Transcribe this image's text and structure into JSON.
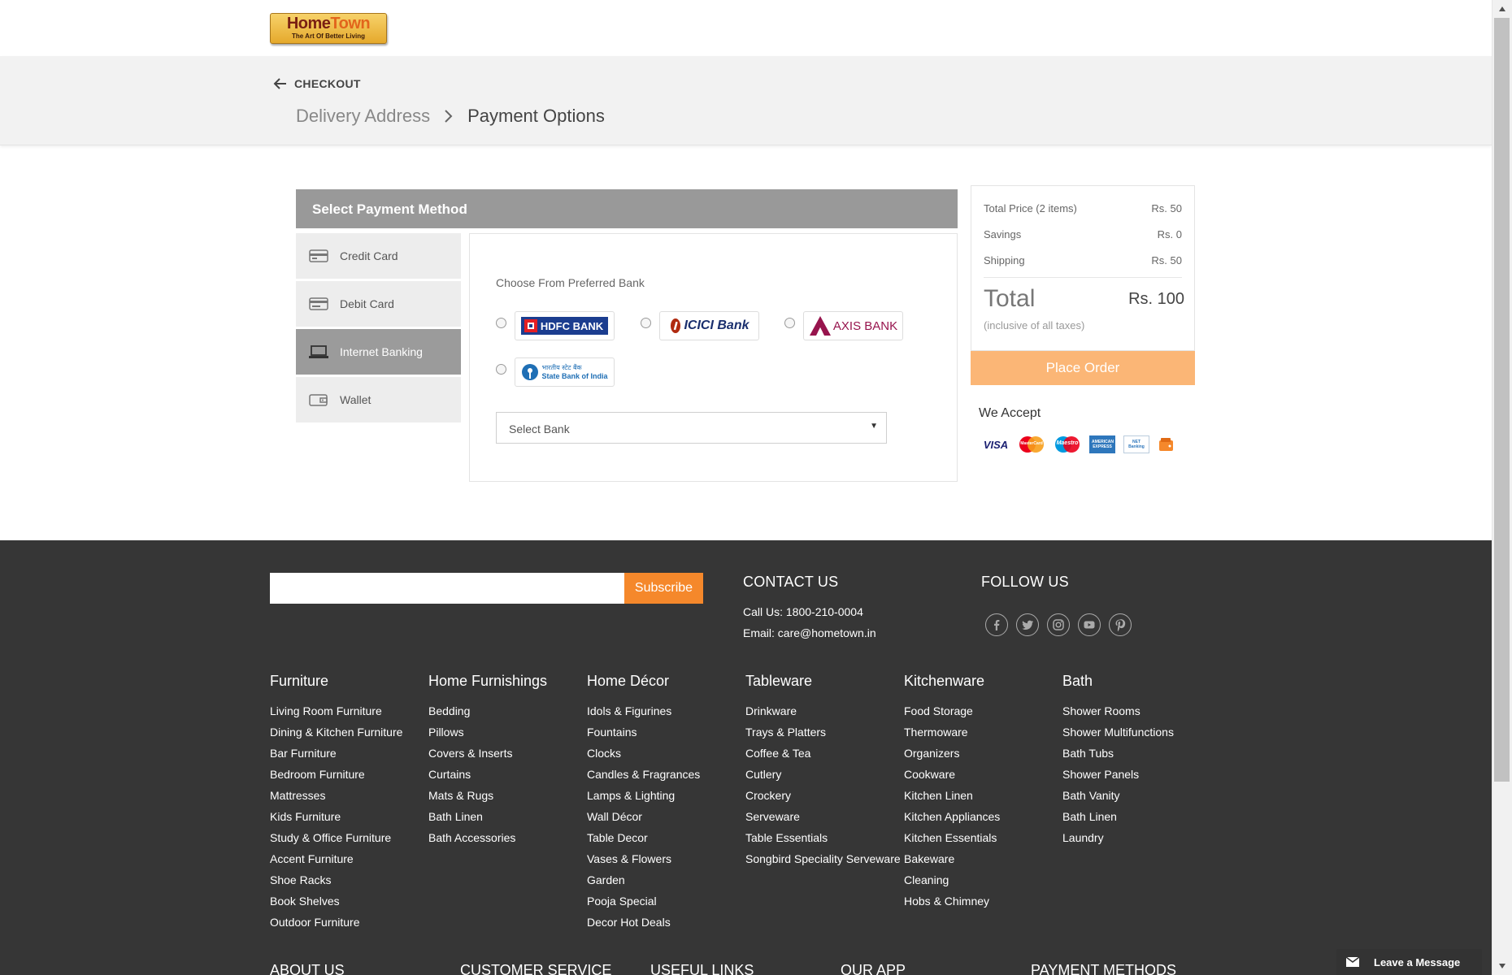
{
  "brand": {
    "name_a": "Home",
    "name_b": "Town",
    "tagline": "The Art Of Better Living"
  },
  "checkout": {
    "back_label": "CHECKOUT",
    "breadcrumb": [
      "Delivery Address",
      "Payment Options"
    ]
  },
  "payment": {
    "header": "Select Payment Method",
    "methods": [
      {
        "label": "Credit Card",
        "icon": "credit-card-icon",
        "active": false
      },
      {
        "label": "Debit Card",
        "icon": "debit-card-icon",
        "active": false
      },
      {
        "label": "Internet Banking",
        "icon": "laptop-icon",
        "active": true
      },
      {
        "label": "Wallet",
        "icon": "wallet-icon",
        "active": false
      }
    ],
    "choose_label": "Choose From Preferred Bank",
    "banks": [
      {
        "name": "HDFC BANK",
        "color": "#1b3d8f",
        "accent": "#e31e24"
      },
      {
        "name": "ICICI Bank",
        "color": "#1a2f6e",
        "accent": "#b02a10"
      },
      {
        "name": "AXIS BANK",
        "color": "#97144d"
      },
      {
        "name_hindi": "भारतीय स्टेट बैंक",
        "name": "State Bank of India",
        "color": "#1f6fb5"
      }
    ],
    "select_placeholder": "Select Bank"
  },
  "summary": {
    "total_price_label": "Total Price (2 items)",
    "total_price_value": "Rs. 50",
    "savings_label": "Savings",
    "savings_value": "Rs. 0",
    "shipping_label": "Shipping",
    "shipping_value": "Rs. 50",
    "total_label": "Total",
    "total_value": "Rs. 100",
    "inclusive": "(inclusive of all taxes)",
    "place_order": "Place Order",
    "accept_label": "We Accept",
    "card_logos": {
      "visa": "VISA",
      "mastercard": "MasterCard",
      "maestro": "Maestro",
      "amex": "AMERICAN EXPRESS",
      "netbanking": "NET Banking",
      "wallet": "wallet-icon"
    }
  },
  "footer": {
    "subscribe_label": "Subscribe",
    "contact_title": "CONTACT US",
    "call": "Call Us: 1800-210-0004",
    "email": "Email: care@hometown.in",
    "follow_title": "FOLLOW US",
    "social": [
      "facebook-icon",
      "twitter-icon",
      "instagram-icon",
      "youtube-icon",
      "pinterest-icon"
    ],
    "columns": [
      {
        "title": "Furniture",
        "links": [
          "Living Room Furniture",
          "Dining & Kitchen Furniture",
          "Bar Furniture",
          "Bedroom Furniture",
          "Mattresses",
          "Kids Furniture",
          "Study & Office Furniture",
          "Accent Furniture",
          "Shoe Racks",
          "Book Shelves",
          "Outdoor Furniture"
        ]
      },
      {
        "title": "Home Furnishings",
        "links": [
          "Bedding",
          "Pillows",
          "Covers & Inserts",
          "Curtains",
          "Mats & Rugs",
          "Bath Linen",
          "Bath Accessories"
        ]
      },
      {
        "title": "Home Décor",
        "links": [
          "Idols & Figurines",
          "Fountains",
          "Clocks",
          "Candles & Fragrances",
          "Lamps & Lighting",
          "Wall Décor",
          "Table Decor",
          "Vases & Flowers",
          "Garden",
          "Pooja Special",
          "Decor Hot Deals"
        ]
      },
      {
        "title": "Tableware",
        "links": [
          "Drinkware",
          "Trays & Platters",
          "Coffee & Tea",
          "Cutlery",
          "Crockery",
          "Serveware",
          "Table Essentials",
          "Songbird Speciality Serveware"
        ]
      },
      {
        "title": "Kitchenware",
        "links": [
          "Food Storage",
          "Thermoware",
          "Organizers",
          "Cookware",
          "Kitchen Linen",
          "Kitchen Appliances",
          "Kitchen Essentials",
          "Bakeware",
          "Cleaning",
          "Hobs & Chimney"
        ]
      },
      {
        "title": "Bath",
        "links": [
          "Shower Rooms",
          "Shower Multifunctions",
          "Bath Tubs",
          "Shower Panels",
          "Bath Vanity",
          "Bath Linen",
          "Laundry"
        ]
      }
    ],
    "bottom_headings": [
      "ABOUT US",
      "CUSTOMER SERVICE",
      "USEFUL LINKS",
      "OUR APP",
      "PAYMENT METHODS"
    ]
  },
  "chat": {
    "label": "Leave a Message"
  },
  "colors": {
    "accent": "#f5882b",
    "place_order": "#fbb676",
    "footer_bg": "#363636",
    "active_method": "#9b9b9b"
  }
}
